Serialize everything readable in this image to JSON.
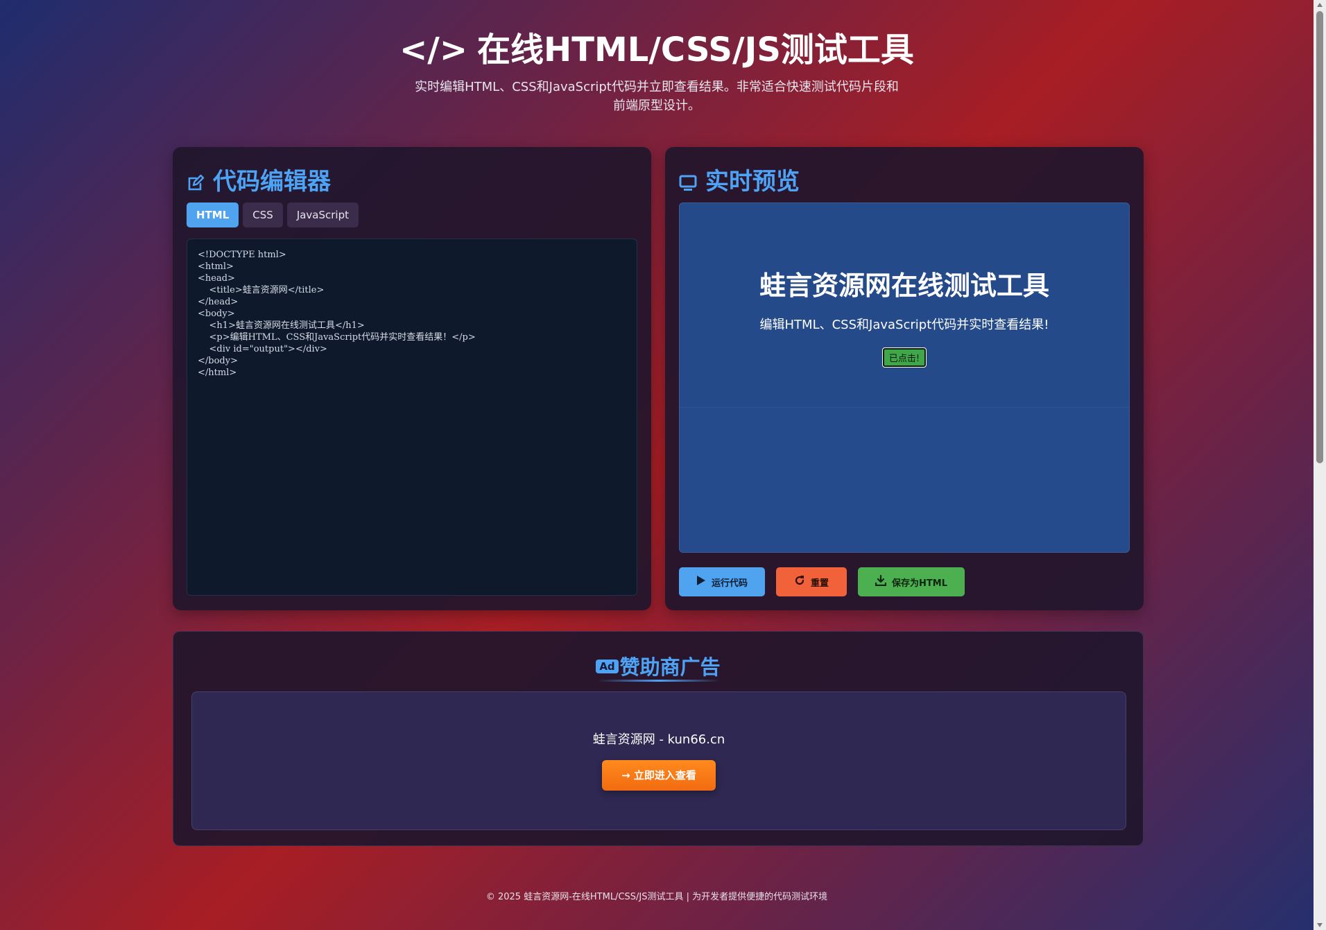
{
  "header": {
    "title_icon": "</>",
    "title": "在线HTML/CSS/JS测试工具",
    "subtitle": "实时编辑HTML、CSS和JavaScript代码并立即查看结果。非常适合快速测试代码片段和前端原型设计。"
  },
  "editor": {
    "title": "代码编辑器",
    "tabs": [
      "HTML",
      "CSS",
      "JavaScript"
    ],
    "active_tab": "HTML",
    "code": "<!DOCTYPE html>\n<html>\n<head>\n    <title>蛙言资源网</title>\n</head>\n<body>\n    <h1>蛙言资源网在线测试工具</h1>\n    <p>编辑HTML、CSS和JavaScript代码并实时查看结果！</p>\n    <div id=\"output\"></div>\n</body>\n</html>"
  },
  "preview": {
    "title": "实时预览",
    "heading": "蛙言资源网在线测试工具",
    "text": "编辑HTML、CSS和JavaScript代码并实时查看结果!",
    "badge": "已点击!",
    "buttons": {
      "run": "运行代码",
      "reset": "重置",
      "save": "保存为HTML"
    }
  },
  "sponsor": {
    "ad_label": "Ad",
    "title": "赞助商广告",
    "name": "蛙言资源网 - kun66.cn",
    "cta": "立即进入查看"
  },
  "footer": {
    "text": "© 2025 蛙言资源网-在线HTML/CSS/JS测试工具 | 为开发者提供便捷的代码测试环境"
  },
  "colors": {
    "accent": "#4da3f5",
    "run": "#4fa3ef",
    "reset": "#f2623a",
    "save": "#4caf50",
    "cta": "#ff8a1e"
  },
  "icons": [
    "code-icon",
    "edit-icon",
    "monitor-icon",
    "play-icon",
    "redo-icon",
    "download-icon",
    "arrow-right-icon"
  ]
}
